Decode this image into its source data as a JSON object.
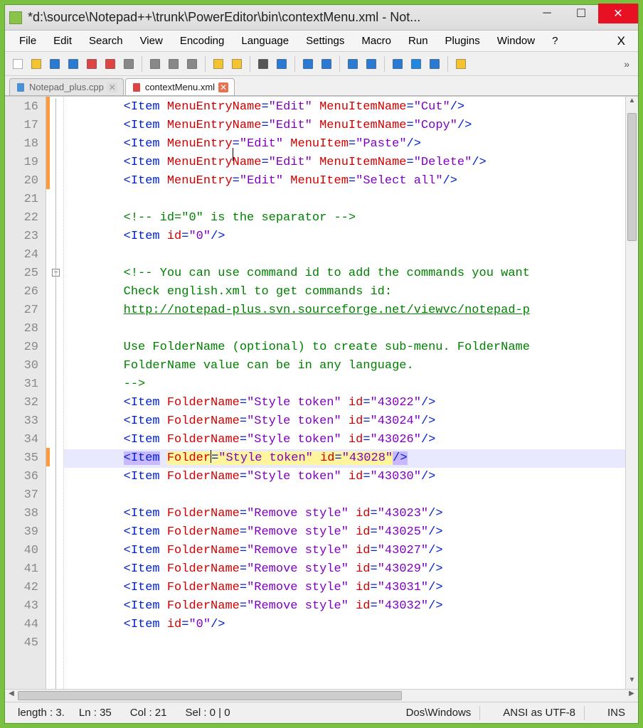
{
  "title": "*d:\\source\\Notepad++\\trunk\\PowerEditor\\bin\\contextMenu.xml - Not...",
  "menu": [
    "File",
    "Edit",
    "Search",
    "View",
    "Encoding",
    "Language",
    "Settings",
    "Macro",
    "Run",
    "Plugins",
    "Window",
    "?"
  ],
  "menu_close": "X",
  "toolbar_overflow": "»",
  "tabs": [
    {
      "label": "Notepad_plus.cpp",
      "active": false,
      "icon": "file-blue"
    },
    {
      "label": "contextMenu.xml",
      "active": true,
      "icon": "file-red"
    }
  ],
  "gutter_start": 16,
  "gutter_end": 45,
  "fold_marker_line": 25,
  "lines": [
    {
      "n": 16,
      "html": "        <span class='tag'>&lt;Item</span> <span class='attr'>MenuEntryName</span><span class='tag'>=</span><span class='val'>\"Edit\"</span> <span class='attr'>MenuItemName</span><span class='tag'>=</span><span class='val'>\"Cut\"</span><span class='tag'>/&gt;</span>"
    },
    {
      "n": 17,
      "html": "        <span class='tag'>&lt;Item</span> <span class='attr'>MenuEntryName</span><span class='tag'>=</span><span class='val'>\"Edit\"</span> <span class='attr'>MenuItemName</span><span class='tag'>=</span><span class='val'>\"Copy\"</span><span class='tag'>/&gt;</span>"
    },
    {
      "n": 18,
      "html": "        <span class='tag'>&lt;Item</span> <span class='attr'>MenuEntry</span><span class='text-cursor'></span><span class='tag'>=</span><span class='val'>\"Edit\"</span> <span class='attr'>MenuItem</span><span class='tag'>=</span><span class='val'>\"Paste\"</span><span class='tag'>/&gt;</span>"
    },
    {
      "n": 19,
      "html": "        <span class='tag'>&lt;Item</span> <span class='attr'>MenuEntryName</span><span class='tag'>=</span><span class='val'>\"Edit\"</span> <span class='attr'>MenuItemName</span><span class='tag'>=</span><span class='val'>\"Delete\"</span><span class='tag'>/&gt;</span>"
    },
    {
      "n": 20,
      "html": "        <span class='tag'>&lt;Item</span> <span class='attr'>MenuEntry</span><span class='tag'>=</span><span class='val'>\"Edit\"</span> <span class='attr'>MenuItem</span><span class='tag'>=</span><span class='val'>\"Select all\"</span><span class='tag'>/&gt;</span>"
    },
    {
      "n": 21,
      "html": ""
    },
    {
      "n": 22,
      "html": "        <span class='cm-green'>&lt;!-- id=\"0\" is the separator --&gt;</span>"
    },
    {
      "n": 23,
      "html": "        <span class='tag'>&lt;Item</span> <span class='attr'>id</span><span class='tag'>=</span><span class='val'>\"0\"</span><span class='tag'>/&gt;</span>"
    },
    {
      "n": 24,
      "html": ""
    },
    {
      "n": 25,
      "html": "        <span class='cm-green'>&lt;!-- You can use command id to add the commands you want</span>"
    },
    {
      "n": 26,
      "html": "        <span class='cm-green'>Check english.xml to get commands id:</span>"
    },
    {
      "n": 27,
      "html": "        <span class='cm-link'>http://notepad-plus.svn.sourceforge.net/viewvc/notepad-p</span>"
    },
    {
      "n": 28,
      "html": ""
    },
    {
      "n": 29,
      "html": "        <span class='cm-green'>Use FolderName (optional) to create sub-menu. FolderName</span>"
    },
    {
      "n": 30,
      "html": "        <span class='cm-green'>FolderName value can be in any language.</span>"
    },
    {
      "n": 31,
      "html": "        <span class='cm-green'>--&gt;</span>"
    },
    {
      "n": 32,
      "html": "        <span class='tag'>&lt;Item</span> <span class='attr'>FolderName</span><span class='tag'>=</span><span class='val'>\"Style token\"</span> <span class='attr'>id</span><span class='tag'>=</span><span class='val'>\"43022\"</span><span class='tag'>/&gt;</span>"
    },
    {
      "n": 33,
      "html": "        <span class='tag'>&lt;Item</span> <span class='attr'>FolderName</span><span class='tag'>=</span><span class='val'>\"Style token\"</span> <span class='attr'>id</span><span class='tag'>=</span><span class='val'>\"43024\"</span><span class='tag'>/&gt;</span>"
    },
    {
      "n": 34,
      "html": "        <span class='tag'>&lt;Item</span> <span class='attr'>FolderName</span><span class='tag'>=</span><span class='val'>\"Style token\"</span> <span class='attr'>id</span><span class='tag'>=</span><span class='val'>\"43026\"</span><span class='tag'>/&gt;</span>"
    },
    {
      "n": 35,
      "hl": true,
      "html": "        <span class='sel-p'><span class='tag'>&lt;Item</span></span> <span class='sel-y'><span class='attr'>Folder</span></span><span class='caret'></span><span class='sel-y'><span class='tag'>=</span><span class='val'>\"Style token\"</span> <span class='attr'>id</span><span class='tag'>=</span><span class='val'>\"43028\"</span></span><span class='sel-p'><span class='tag'>/&gt;</span></span>"
    },
    {
      "n": 36,
      "html": "        <span class='tag'>&lt;Item</span> <span class='attr'>FolderName</span><span class='tag'>=</span><span class='val'>\"Style token\"</span> <span class='attr'>id</span><span class='tag'>=</span><span class='val'>\"43030\"</span><span class='tag'>/&gt;</span>"
    },
    {
      "n": 37,
      "html": ""
    },
    {
      "n": 38,
      "html": "        <span class='tag'>&lt;Item</span> <span class='attr'>FolderName</span><span class='tag'>=</span><span class='val'>\"Remove style\"</span> <span class='attr'>id</span><span class='tag'>=</span><span class='val'>\"43023\"</span><span class='tag'>/&gt;</span>"
    },
    {
      "n": 39,
      "html": "        <span class='tag'>&lt;Item</span> <span class='attr'>FolderName</span><span class='tag'>=</span><span class='val'>\"Remove style\"</span> <span class='attr'>id</span><span class='tag'>=</span><span class='val'>\"43025\"</span><span class='tag'>/&gt;</span>"
    },
    {
      "n": 40,
      "html": "        <span class='tag'>&lt;Item</span> <span class='attr'>FolderName</span><span class='tag'>=</span><span class='val'>\"Remove style\"</span> <span class='attr'>id</span><span class='tag'>=</span><span class='val'>\"43027\"</span><span class='tag'>/&gt;</span>"
    },
    {
      "n": 41,
      "html": "        <span class='tag'>&lt;Item</span> <span class='attr'>FolderName</span><span class='tag'>=</span><span class='val'>\"Remove style\"</span> <span class='attr'>id</span><span class='tag'>=</span><span class='val'>\"43029\"</span><span class='tag'>/&gt;</span>"
    },
    {
      "n": 42,
      "html": "        <span class='tag'>&lt;Item</span> <span class='attr'>FolderName</span><span class='tag'>=</span><span class='val'>\"Remove style\"</span> <span class='attr'>id</span><span class='tag'>=</span><span class='val'>\"43031\"</span><span class='tag'>/&gt;</span>"
    },
    {
      "n": 43,
      "html": "        <span class='tag'>&lt;Item</span> <span class='attr'>FolderName</span><span class='tag'>=</span><span class='val'>\"Remove style\"</span> <span class='attr'>id</span><span class='tag'>=</span><span class='val'>\"43032\"</span><span class='tag'>/&gt;</span>"
    },
    {
      "n": 44,
      "html": "        <span class='tag'>&lt;Item</span> <span class='attr'>id</span><span class='tag'>=</span><span class='val'>\"0\"</span><span class='tag'>/&gt;</span>"
    },
    {
      "n": 45,
      "html": ""
    }
  ],
  "status": {
    "length": "length : 3.",
    "ln": "Ln : 35",
    "col": "Col : 21",
    "sel": "Sel : 0 | 0",
    "eol": "Dos\\Windows",
    "enc": "ANSI as UTF-8",
    "ins": "INS"
  },
  "toolbar_icons": [
    "new",
    "open",
    "save",
    "save-all",
    "close",
    "close-all",
    "print",
    "cut",
    "copy",
    "paste",
    "undo",
    "redo",
    "find",
    "replace",
    "zoom-in",
    "zoom-out",
    "sync-v",
    "sync-h",
    "wrap",
    "show-all",
    "indent-guide",
    "doc-map"
  ]
}
